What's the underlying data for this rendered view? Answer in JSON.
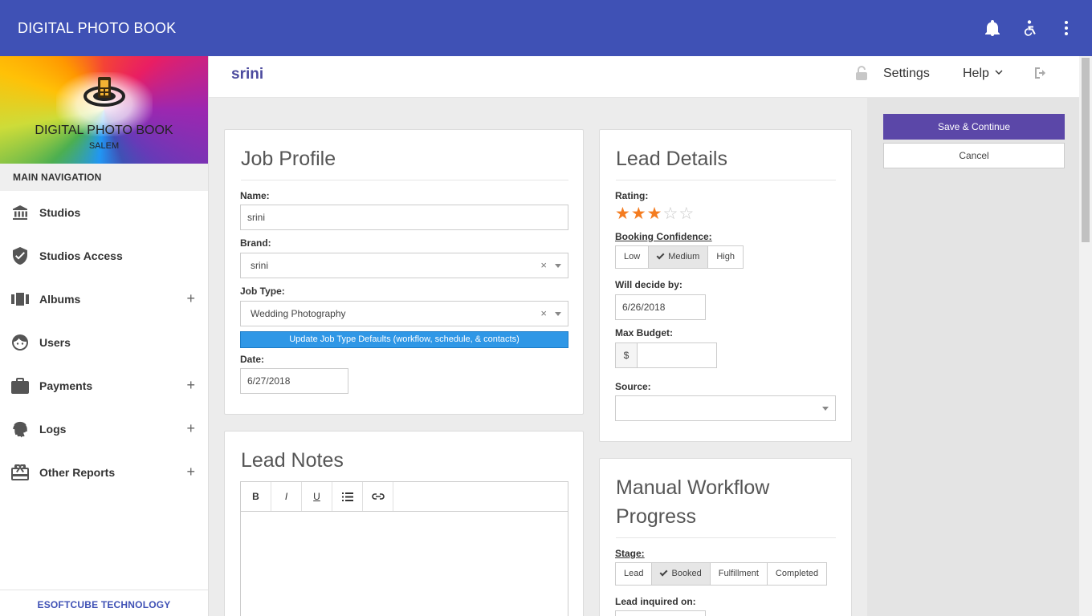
{
  "app": {
    "title": "DIGITAL PHOTO BOOK"
  },
  "brand": {
    "name": "DIGITAL PHOTO BOOK",
    "city": "SALEM"
  },
  "nav": {
    "header": "MAIN NAVIGATION",
    "items": [
      {
        "label": "Studios",
        "icon": "bank-icon",
        "expandable": false
      },
      {
        "label": "Studios Access",
        "icon": "shield-icon",
        "expandable": false
      },
      {
        "label": "Albums",
        "icon": "albums-icon",
        "expandable": true
      },
      {
        "label": "Users",
        "icon": "face-icon",
        "expandable": false
      },
      {
        "label": "Payments",
        "icon": "briefcase-icon",
        "expandable": true
      },
      {
        "label": "Logs",
        "icon": "fingerprint-icon",
        "expandable": true
      },
      {
        "label": "Other Reports",
        "icon": "gift-icon",
        "expandable": true
      }
    ],
    "expand_symbol": "+",
    "footer": "ESOFTCUBE TECHNOLOGY"
  },
  "subheader": {
    "user": "srini",
    "settings": "Settings",
    "help": "Help"
  },
  "actions": {
    "save": "Save & Continue",
    "cancel": "Cancel"
  },
  "job_profile": {
    "title": "Job Profile",
    "name_label": "Name:",
    "name_value": "srini",
    "brand_label": "Brand:",
    "brand_value": "srini",
    "job_type_label": "Job Type:",
    "job_type_value": "Wedding Photography",
    "update_button": "Update Job Type Defaults (workflow, schedule, & contacts)",
    "date_label": "Date:",
    "date_value": "6/27/2018",
    "clear_symbol": "×"
  },
  "lead_notes": {
    "title": "Lead Notes",
    "toolbar": {
      "bold": "B",
      "italic": "I",
      "underline": "U"
    }
  },
  "lead_details": {
    "title": "Lead Details",
    "rating_label": "Rating:",
    "rating": 3,
    "rating_max": 5,
    "confidence_label": "Booking Confidence:",
    "confidence_options": [
      "Low",
      "Medium",
      "High"
    ],
    "confidence_selected": "Medium",
    "decide_label": "Will decide by:",
    "decide_value": "6/26/2018",
    "budget_label": "Max Budget:",
    "budget_prefix": "$",
    "budget_value": "",
    "source_label": "Source:",
    "source_value": ""
  },
  "workflow": {
    "title_line1": "Manual Workflow",
    "title_line2": "Progress",
    "stage_label": "Stage:",
    "stage_options": [
      "Lead",
      "Booked",
      "Fulfillment",
      "Completed"
    ],
    "stage_selected": "Booked",
    "inquired_label": "Lead inquired on:"
  },
  "colors": {
    "primary": "#3f51b5",
    "accent": "#5b47a8",
    "star": "#f47c20",
    "info": "#2f97e6"
  }
}
